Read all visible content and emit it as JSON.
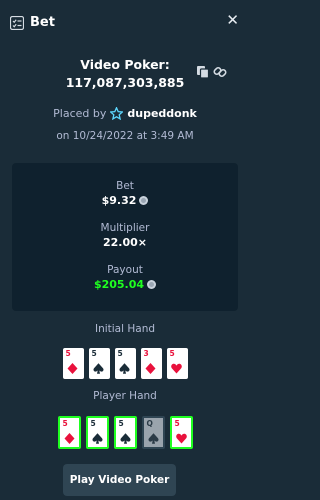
{
  "header": {
    "title": "Bet"
  },
  "game": {
    "name": "Video Poker:",
    "bet_id": "117,087,303,885"
  },
  "placed": {
    "prefix": "Placed by",
    "username": "dupeddonk",
    "date": "on 10/24/2022 at 3:49 AM"
  },
  "stats": {
    "bet_label": "Bet",
    "bet_value": "$9.32",
    "multiplier_label": "Multiplier",
    "multiplier_value": "22.00×",
    "payout_label": "Payout",
    "payout_value": "$205.04"
  },
  "initial_hand": {
    "label": "Initial Hand",
    "cards": [
      {
        "rank": "5",
        "suit": "diamond",
        "color": "red"
      },
      {
        "rank": "5",
        "suit": "spade",
        "color": "black"
      },
      {
        "rank": "5",
        "suit": "spade",
        "color": "black"
      },
      {
        "rank": "3",
        "suit": "diamond",
        "color": "red"
      },
      {
        "rank": "5",
        "suit": "heart",
        "color": "red"
      }
    ]
  },
  "player_hand": {
    "label": "Player Hand",
    "cards": [
      {
        "rank": "5",
        "suit": "diamond",
        "color": "red",
        "held": true
      },
      {
        "rank": "5",
        "suit": "spade",
        "color": "black",
        "held": true
      },
      {
        "rank": "5",
        "suit": "spade",
        "color": "black",
        "held": true
      },
      {
        "rank": "Q",
        "suit": "spade",
        "color": "black",
        "held": false
      },
      {
        "rank": "5",
        "suit": "heart",
        "color": "red",
        "held": true
      }
    ]
  },
  "button": {
    "label": "Play Video Poker"
  },
  "colors": {
    "background": "#1a2c38",
    "panel": "#0f212e",
    "accent_green": "#1fff20",
    "muted": "#b1bad3",
    "button": "#2f4553"
  },
  "icons": {
    "header": "bet-list-icon",
    "close": "close-icon",
    "copy": "copy-icon",
    "link": "link-icon",
    "vip": "vip-star-icon",
    "currency": "coin-icon"
  }
}
